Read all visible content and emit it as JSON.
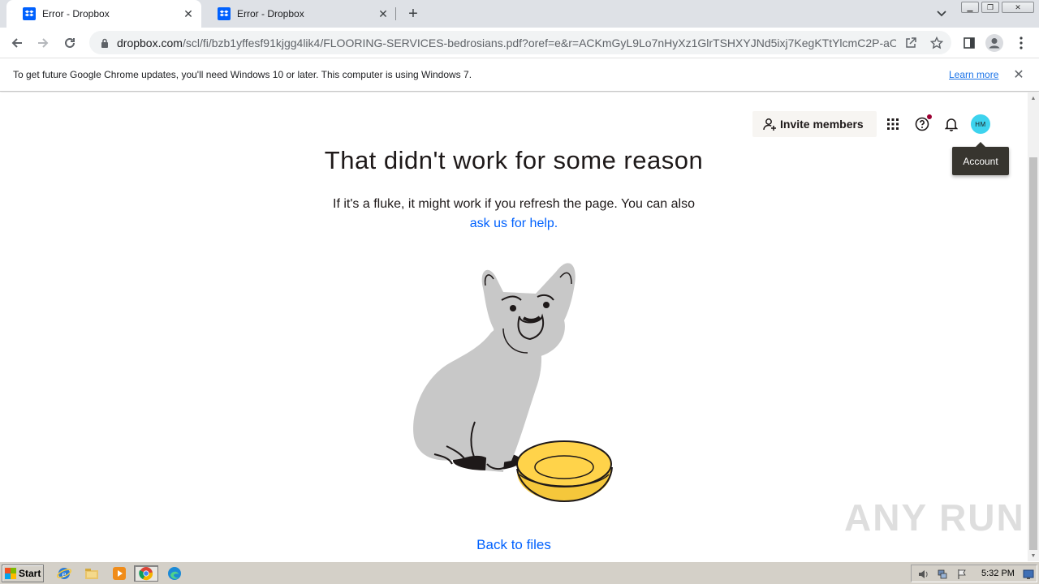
{
  "browser": {
    "tabs": [
      {
        "title": "Error - Dropbox",
        "active": true
      },
      {
        "title": "Error - Dropbox",
        "active": false
      }
    ],
    "url_host": "dropbox.com",
    "url_path": "/scl/fi/bzb1yffesf91kjgg4lik4/FLOORING-SERVICES-bedrosians.pdf?oref=e&r=ACKmGyL9Lo7nHyXz1GlrTSHXYJNd5ixj7KegKTtYlcmC2P-aOud8...",
    "infobar": {
      "message": "To get future Google Chrome updates, you'll need Windows 10 or later. This computer is using Windows 7.",
      "link": "Learn more"
    }
  },
  "dropbox": {
    "invite_label": "Invite members",
    "avatar_initials": "HM",
    "tooltip": "Account",
    "heading": "That didn't work for some reason",
    "subtext": "If it's a fluke, it might work if you refresh the page. You can also",
    "help_link": "ask us for help.",
    "back_link": "Back to files",
    "accent_color": "#0061fe"
  },
  "watermark": "ANY RUN",
  "taskbar": {
    "start_label": "Start",
    "clock": "5:32 PM",
    "pinned": [
      "ie-icon",
      "explorer-icon",
      "media-player-icon",
      "chrome-icon",
      "edge-icon"
    ]
  }
}
